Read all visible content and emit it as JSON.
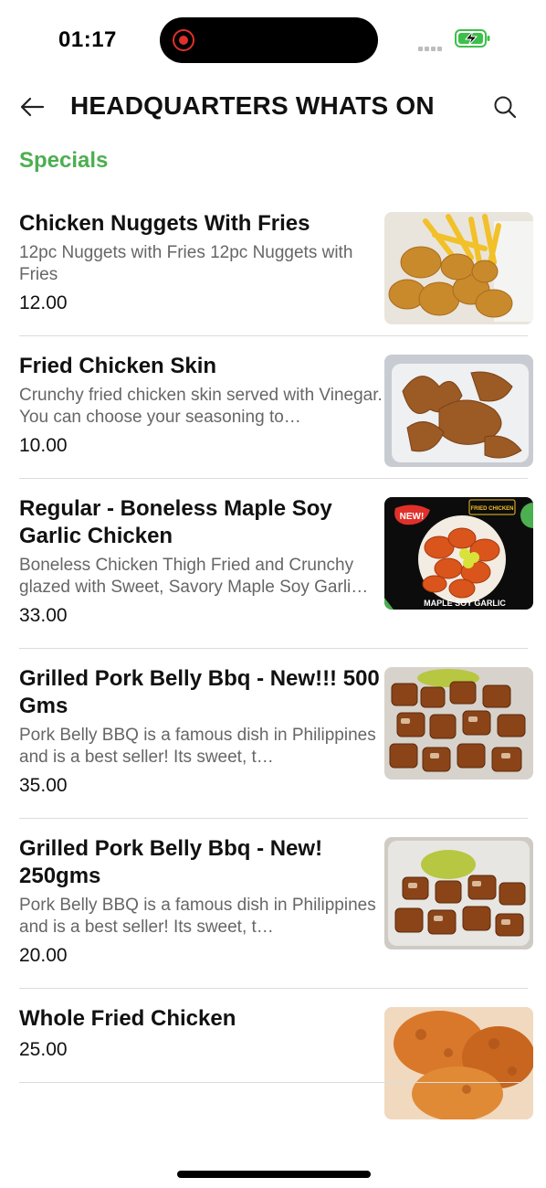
{
  "status_bar": {
    "time": "01:17"
  },
  "header": {
    "title": "HEADQUARTERS WHATS ON"
  },
  "section": {
    "title": "Specials"
  },
  "items": [
    {
      "name": "Chicken Nuggets With Fries",
      "description": "12pc Nuggets with Fries 12pc Nuggets with Fries",
      "price": "12.00"
    },
    {
      "name": "Fried Chicken Skin",
      "description": "Crunchy fried chicken skin served with Vinegar.  You can choose your seasoning to…",
      "price": "10.00"
    },
    {
      "name": "Regular - Boneless Maple Soy Garlic Chicken",
      "description": "Boneless Chicken Thigh Fried and Crunchy glazed with Sweet, Savory Maple Soy Garli…",
      "price": "33.00",
      "badge": "NEW!",
      "brand": "FRIED CHICKEN",
      "caption": "MAPLE SOY GARLIC"
    },
    {
      "name": "Grilled Pork Belly Bbq - New!!! 500 Gms",
      "description": "Pork Belly BBQ is a famous dish in Philippines and is a best seller! Its sweet, t…",
      "price": "35.00"
    },
    {
      "name": "Grilled Pork Belly Bbq - New! 250gms",
      "description": "Pork Belly BBQ is a famous dish in Philippines and is a best seller! Its sweet, t…",
      "price": "20.00"
    },
    {
      "name": "Whole Fried Chicken",
      "description": "",
      "price": "25.00"
    }
  ],
  "colors": {
    "accent": "#4caf50",
    "text": "#111111",
    "muted": "#666666",
    "divider": "#dcdcdc"
  },
  "icons": {
    "back": "arrow-left-icon",
    "search": "search-icon",
    "battery": "battery-charging-icon",
    "record": "record-icon"
  }
}
